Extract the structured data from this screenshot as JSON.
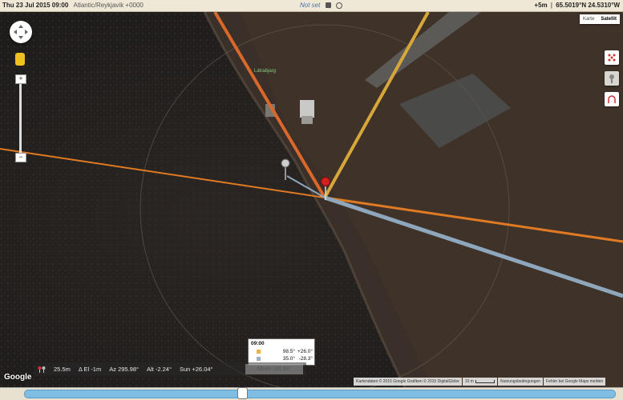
{
  "topbar": {
    "date_time": "Thu 23 Jul 2015 09:00",
    "timezone": "Atlantic/Reykjavik +0000",
    "location_status": "Not set",
    "elevation": "+5m",
    "coordinates": "65.5019°N 24.5310°W"
  },
  "map": {
    "place_label": "Látrabjarg",
    "map_type": {
      "map_label": "Karte",
      "satellite_label": "Satellit",
      "selected": "Satellit"
    },
    "zoom_in_label": "+",
    "zoom_out_label": "−"
  },
  "stats": {
    "height": "25.5m",
    "delta_el_label": "Δ El",
    "delta_el": "-1m",
    "az": "Az 295.98°",
    "alt": "Alt -2.24°",
    "sun": "Sun +26.04°"
  },
  "moon_row": "Moon -28.34°",
  "time_popup": {
    "time": "09:00",
    "sun": {
      "azimuth": "98.5°",
      "altitude": "+26.0°",
      "color": "#f1b33c"
    },
    "moon": {
      "azimuth": "35.0°",
      "altitude": "-28.3°",
      "color": "#9bb0c0"
    }
  },
  "attribution": {
    "google": "Google",
    "data": "Kartendaten © 2015 Google Grafiken © 2015 DigitalGlobe",
    "scale": "10 m",
    "terms": "Nutzungsbedingungen",
    "report": "Fehler bei Google Maps melden"
  },
  "colors": {
    "sunrise_line": "#e07a23",
    "sunset_line": "#d8a73a",
    "moon_line": "#8ea7bd",
    "slider": "#7fbde3"
  },
  "slider": {
    "position_fraction": 0.37
  }
}
